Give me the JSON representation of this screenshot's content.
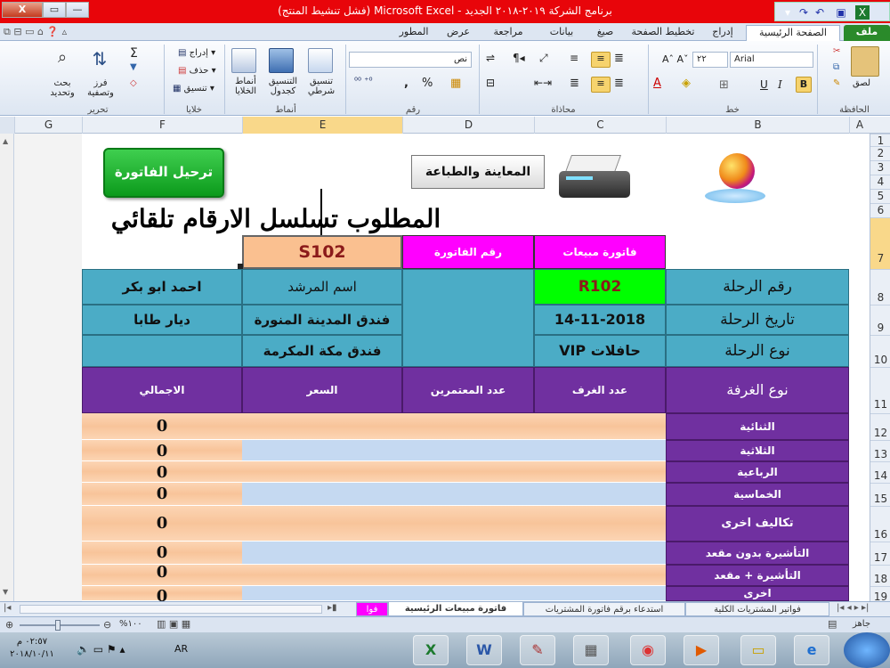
{
  "window": {
    "title": "برنامج الشركة ٢٠١٩-٢٠١٨ الجديد - Microsoft Excel (فشل تنشيط المنتج)",
    "close": "X",
    "restore": "▭",
    "minimize": "—"
  },
  "ribbon": {
    "tabs": [
      "ملف",
      "الصفحة الرئيسية",
      "إدراج",
      "تخطيط الصفحة",
      "صيغ",
      "بيانات",
      "مراجعة",
      "عرض",
      "المطور"
    ],
    "groups": {
      "clipboard": {
        "label": "الحافظة",
        "paste": "لصق"
      },
      "font": {
        "label": "خط",
        "name": "Arial",
        "size": "٢٢",
        "bold": "B",
        "italic": "I",
        "underline": "U"
      },
      "alignment": {
        "label": "محاذاة"
      },
      "number": {
        "label": "رقم",
        "format": "نص",
        "percent": "%",
        "comma": ","
      },
      "styles": {
        "label": "أنماط",
        "conditional": "تنسيق شرطي",
        "table": "التنسيق كجدول",
        "cell": "أنماط الخلايا"
      },
      "cells": {
        "label": "خلايا",
        "insert": "إدراج",
        "delete": "حذف",
        "format": "تنسيق"
      },
      "editing": {
        "label": "تحرير",
        "sort": "فرز وتصفية",
        "find": "بحث وتحديد",
        "sigma": "Σ"
      }
    }
  },
  "columns": [
    "A",
    "B",
    "C",
    "D",
    "E",
    "F",
    "G"
  ],
  "rows": [
    "1",
    "2",
    "3",
    "4",
    "5",
    "6",
    "7",
    "8",
    "9",
    "10",
    "11",
    "12",
    "13",
    "14",
    "15",
    "16",
    "17",
    "18",
    "19"
  ],
  "sheet": {
    "transfer_button": "ترحيل الفاتورة",
    "print_button": "المعاينة والطباعة",
    "auto_note": "المطلوب تسلسل الارقام تلقائي",
    "invoice_label": "فاتورة مبيعات",
    "invoice_no_label": "رقم الفاتورة",
    "invoice_no": "S102",
    "trip_no_label": "رقم الرحلة",
    "trip_no": "R102",
    "trip_date_label": "تاريخ الرحلة",
    "trip_date": "14-11-2018",
    "trip_type_label": "نوع الرحلة",
    "trip_type": "حافلات VIP",
    "guide_label": "اسم المرشد",
    "guide": "احمد ابو بكر",
    "hotel1": "فندق المدينة المنورة",
    "hotel1_area": "ديار طابا",
    "hotel2": "فندق مكة المكرمة",
    "headers": [
      "نوع الغرفة",
      "عدد الغرف",
      "عدد المعتمرين",
      "السعر",
      "الاجمالي"
    ],
    "room_types": [
      "الثنائية",
      "الثلاثية",
      "الرباعية",
      "الخماسية",
      "تكاليف اخرى",
      "التأشيرة بدون مقعد",
      "التأشيرة + مقعد",
      "اخرى"
    ],
    "totals": [
      "0",
      "0",
      "0",
      "0",
      "0",
      "0",
      "0",
      "0"
    ]
  },
  "sheet_tabs": [
    "فواتير المشتريات الكلية",
    "استدعاء برقم فاتورة المشتريات",
    "فاتورة مبيعات الرئيسية",
    "فوا"
  ],
  "status": {
    "ready": "جاهز",
    "zoom": "%١٠٠"
  },
  "taskbar": {
    "time": "٠٢:٥٧ م",
    "date": "٢٠١٨/١٠/١١",
    "lang": "AR"
  }
}
